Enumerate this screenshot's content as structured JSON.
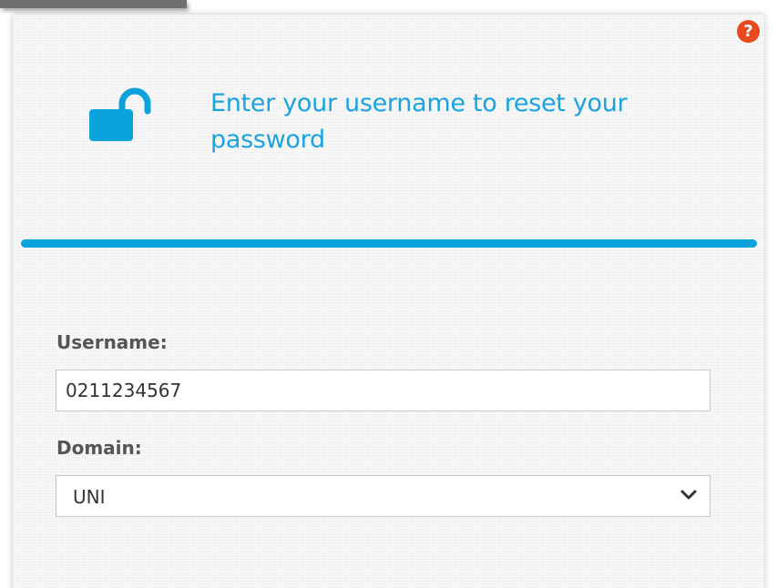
{
  "help": {
    "icon": "question-circle-icon",
    "glyph": "?",
    "color": "#e8491d"
  },
  "header": {
    "icon": "unlocked-padlock-icon",
    "title": "Enter your username to reset your password",
    "accent_color": "#1aa3df"
  },
  "form": {
    "username_label": "Username:",
    "username_value": "0211234567",
    "domain_label": "Domain:",
    "domain_selected": "UNI",
    "domain_dropdown_icon": "chevron-down-icon"
  }
}
